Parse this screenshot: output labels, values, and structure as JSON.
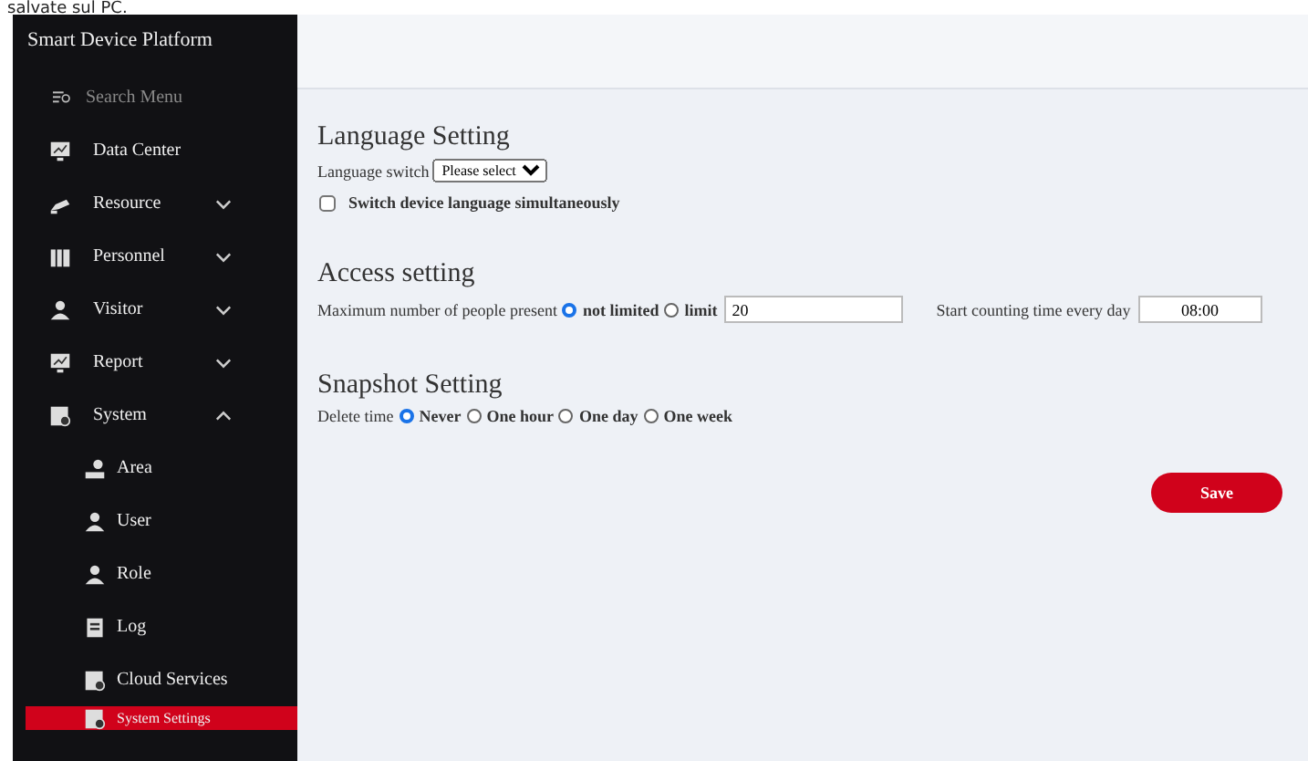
{
  "top_caption": "salvate sul PC.",
  "sidebar": {
    "title": "Smart Device Platform",
    "search": {
      "placeholder": "Search Menu"
    },
    "items": [
      {
        "label": "Data Center",
        "selected": false
      },
      {
        "label": "Resource",
        "expanded": false,
        "selected": false
      },
      {
        "label": "Personnel",
        "expanded": false,
        "selected": false
      },
      {
        "label": "Visitor",
        "expanded": false,
        "selected": false
      },
      {
        "label": "Report",
        "expanded": false,
        "selected": false
      },
      {
        "label": "System",
        "expanded": true,
        "selected": false,
        "children": [
          {
            "label": "Area",
            "selected": false
          },
          {
            "label": "User",
            "selected": false
          },
          {
            "label": "Role",
            "selected": false
          },
          {
            "label": "Log",
            "selected": false
          },
          {
            "label": "Cloud Services",
            "selected": false
          },
          {
            "label": "System Settings",
            "selected": true
          }
        ]
      }
    ]
  },
  "sections": [
    {
      "title": "Language Setting",
      "kind": "language",
      "label": "Language switch",
      "select": "Please select",
      "checkbox": {
        "label": "Switch device language simultaneously",
        "checked": false
      }
    },
    {
      "title": "Access setting",
      "kind": "access",
      "label": "Maximum number of people present",
      "options": [
        {
          "label": "not limited",
          "selected": true
        },
        {
          "label": "limit",
          "selected": false
        }
      ],
      "limit_value": "20",
      "time_label": "Start counting time every day",
      "time_value": "08:00"
    },
    {
      "title": "Snapshot Setting",
      "kind": "snapshot",
      "label": "Delete time",
      "options": [
        {
          "label": "Never",
          "selected": true
        },
        {
          "label": "One hour",
          "selected": false
        },
        {
          "label": "One day",
          "selected": false
        },
        {
          "label": "One week",
          "selected": false
        }
      ]
    }
  ],
  "save_button": "Save"
}
